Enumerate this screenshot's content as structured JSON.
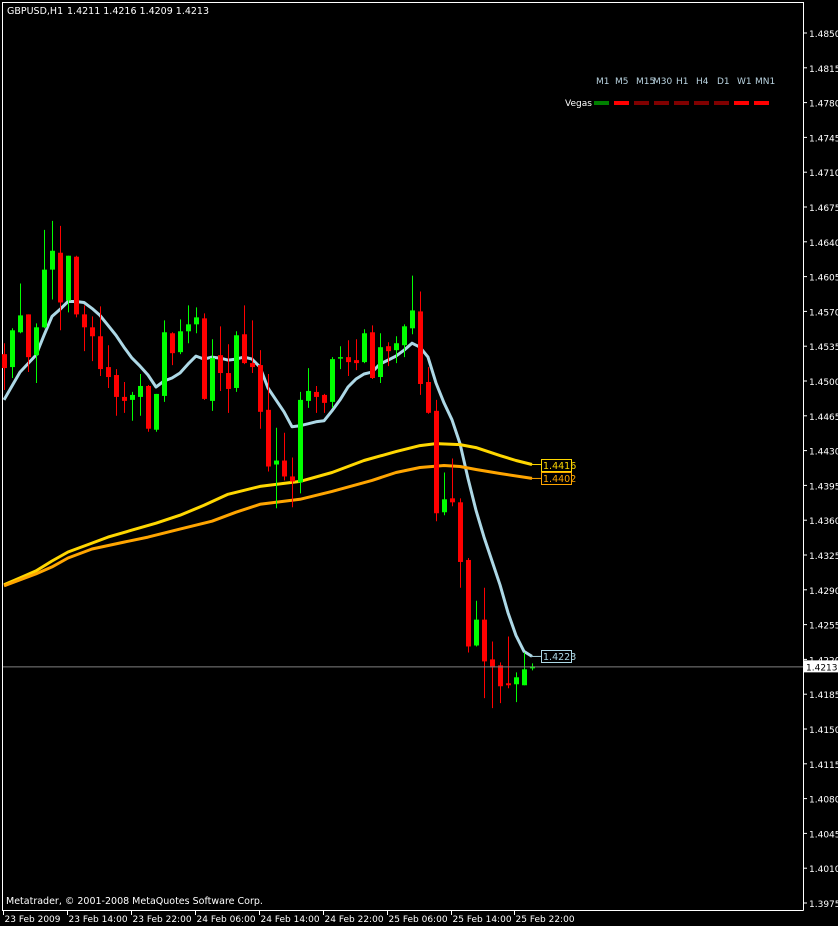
{
  "header": {
    "symbol": "GBPUSD,H1",
    "ohlc": "1.4211 1.4216 1.4209 1.4213"
  },
  "copyright": "Metatrader, © 2001-2008 MetaQuotes Software Corp.",
  "vegas": {
    "label": "Vegas",
    "timeframes": [
      {
        "name": "M1",
        "color": "#008000"
      },
      {
        "name": "M5",
        "color": "#ff0000"
      },
      {
        "name": "M15",
        "color": "#800000"
      },
      {
        "name": "M30",
        "color": "#800000"
      },
      {
        "name": "H1",
        "color": "#800000"
      },
      {
        "name": "H4",
        "color": "#800000"
      },
      {
        "name": "D1",
        "color": "#800000"
      },
      {
        "name": "W1",
        "color": "#ff0000"
      },
      {
        "name": "MN1",
        "color": "#ff0000"
      }
    ]
  },
  "chart_data": {
    "type": "candlestick",
    "symbol": "GBPUSD",
    "timeframe": "H1",
    "ylim": [
      1.3975,
      1.485
    ],
    "y_ticks": [
      "1.4850",
      "1.4815",
      "1.4780",
      "1.4745",
      "1.4710",
      "1.4675",
      "1.4640",
      "1.4605",
      "1.4570",
      "1.4535",
      "1.4500",
      "1.4465",
      "1.4430",
      "1.4395",
      "1.4360",
      "1.4325",
      "1.4290",
      "1.4255",
      "1.4220",
      "1.4185",
      "1.4150",
      "1.4115",
      "1.4080",
      "1.4045",
      "1.4010",
      "1.3975"
    ],
    "x_ticks": [
      "23 Feb 2009",
      "23 Feb 14:00",
      "23 Feb 22:00",
      "24 Feb 06:00",
      "24 Feb 14:00",
      "24 Feb 22:00",
      "25 Feb 06:00",
      "25 Feb 14:00",
      "25 Feb 22:00"
    ],
    "colors": {
      "bull": "#00ff00",
      "bear": "#ff0000",
      "background": "#000000",
      "grid": "off"
    },
    "current_price": "1.4213",
    "candles_fields": [
      "time",
      "open",
      "high",
      "low",
      "close"
    ],
    "candles": [
      [
        "23 Feb 06:00",
        1.4527,
        1.4538,
        1.4491,
        1.4513
      ],
      [
        "23 Feb 07:00",
        1.4514,
        1.4553,
        1.4503,
        1.4551
      ],
      [
        "23 Feb 08:00",
        1.4549,
        1.4598,
        1.4548,
        1.4566
      ],
      [
        "23 Feb 09:00",
        1.4567,
        1.4567,
        1.4509,
        1.4524
      ],
      [
        "23 Feb 10:00",
        1.4526,
        1.4558,
        1.4498,
        1.4554
      ],
      [
        "23 Feb 11:00",
        1.4554,
        1.4652,
        1.4553,
        1.4612
      ],
      [
        "23 Feb 12:00",
        1.4612,
        1.4661,
        1.4582,
        1.4631
      ],
      [
        "23 Feb 13:00",
        1.4629,
        1.4656,
        1.4551,
        1.4579
      ],
      [
        "23 Feb 14:00",
        1.4581,
        1.4626,
        1.4569,
        1.4626
      ],
      [
        "23 Feb 15:00",
        1.4625,
        1.4626,
        1.4564,
        1.4567
      ],
      [
        "23 Feb 16:00",
        1.4567,
        1.4576,
        1.453,
        1.4554
      ],
      [
        "23 Feb 17:00",
        1.4554,
        1.4565,
        1.452,
        1.4545
      ],
      [
        "23 Feb 18:00",
        1.4545,
        1.4575,
        1.4505,
        1.4512
      ],
      [
        "23 Feb 19:00",
        1.4514,
        1.4536,
        1.4493,
        1.4504
      ],
      [
        "23 Feb 20:00",
        1.4506,
        1.4512,
        1.4465,
        1.4484
      ],
      [
        "23 Feb 21:00",
        1.4484,
        1.4499,
        1.4468,
        1.448
      ],
      [
        "23 Feb 22:00",
        1.4481,
        1.4489,
        1.446,
        1.4486
      ],
      [
        "23 Feb 23:00",
        1.4484,
        1.4507,
        1.4465,
        1.4495
      ],
      [
        "24 Feb 00:00",
        1.4495,
        1.4496,
        1.4449,
        1.4452
      ],
      [
        "24 Feb 01:00",
        1.4451,
        1.4487,
        1.4449,
        1.4487
      ],
      [
        "24 Feb 02:00",
        1.4485,
        1.4561,
        1.4479,
        1.4549
      ],
      [
        "24 Feb 03:00",
        1.4548,
        1.4549,
        1.4516,
        1.4528
      ],
      [
        "24 Feb 04:00",
        1.4529,
        1.4562,
        1.4527,
        1.455
      ],
      [
        "24 Feb 05:00",
        1.455,
        1.4576,
        1.4538,
        1.4557
      ],
      [
        "24 Feb 06:00",
        1.4557,
        1.4574,
        1.4548,
        1.4564
      ],
      [
        "24 Feb 07:00",
        1.4563,
        1.4568,
        1.4481,
        1.4482
      ],
      [
        "24 Feb 08:00",
        1.448,
        1.4542,
        1.447,
        1.4523
      ],
      [
        "24 Feb 09:00",
        1.4526,
        1.4555,
        1.449,
        1.4508
      ],
      [
        "24 Feb 10:00",
        1.4508,
        1.4537,
        1.4468,
        1.4492
      ],
      [
        "24 Feb 11:00",
        1.4493,
        1.455,
        1.4489,
        1.4546
      ],
      [
        "24 Feb 12:00",
        1.4547,
        1.4576,
        1.4517,
        1.4518
      ],
      [
        "24 Feb 13:00",
        1.4518,
        1.4561,
        1.4508,
        1.4514
      ],
      [
        "24 Feb 14:00",
        1.4516,
        1.4531,
        1.4452,
        1.4469
      ],
      [
        "24 Feb 15:00",
        1.4471,
        1.4507,
        1.4409,
        1.4414
      ],
      [
        "24 Feb 16:00",
        1.4416,
        1.4453,
        1.4372,
        1.442
      ],
      [
        "24 Feb 17:00",
        1.442,
        1.4448,
        1.44,
        1.4404
      ],
      [
        "24 Feb 18:00",
        1.4404,
        1.4423,
        1.4373,
        1.4399
      ],
      [
        "24 Feb 19:00",
        1.4398,
        1.4489,
        1.4387,
        1.4481
      ],
      [
        "24 Feb 20:00",
        1.448,
        1.4513,
        1.4473,
        1.449
      ],
      [
        "24 Feb 21:00",
        1.4489,
        1.4495,
        1.4468,
        1.4484
      ],
      [
        "24 Feb 22:00",
        1.4486,
        1.4487,
        1.4468,
        1.4478
      ],
      [
        "24 Feb 23:00",
        1.4479,
        1.4524,
        1.4473,
        1.4522
      ],
      [
        "25 Feb 00:00",
        1.4523,
        1.4535,
        1.4512,
        1.4524
      ],
      [
        "25 Feb 01:00",
        1.4524,
        1.4541,
        1.4505,
        1.4519
      ],
      [
        "25 Feb 02:00",
        1.4521,
        1.4542,
        1.4511,
        1.4518
      ],
      [
        "25 Feb 03:00",
        1.4519,
        1.4552,
        1.4518,
        1.4548
      ],
      [
        "25 Feb 04:00",
        1.4549,
        1.4556,
        1.4502,
        1.4503
      ],
      [
        "25 Feb 05:00",
        1.4504,
        1.4548,
        1.4498,
        1.4534
      ],
      [
        "25 Feb 06:00",
        1.4535,
        1.4539,
        1.4515,
        1.453
      ],
      [
        "25 Feb 07:00",
        1.4531,
        1.4545,
        1.4518,
        1.4538
      ],
      [
        "25 Feb 08:00",
        1.4536,
        1.4557,
        1.4524,
        1.4555
      ],
      [
        "25 Feb 09:00",
        1.4553,
        1.4606,
        1.4547,
        1.4571
      ],
      [
        "25 Feb 10:00",
        1.457,
        1.459,
        1.4486,
        1.4497
      ],
      [
        "25 Feb 11:00",
        1.4499,
        1.4514,
        1.4467,
        1.4468
      ],
      [
        "25 Feb 12:00",
        1.447,
        1.4481,
        1.4359,
        1.4367
      ],
      [
        "25 Feb 13:00",
        1.4368,
        1.4408,
        1.4365,
        1.4381
      ],
      [
        "25 Feb 14:00",
        1.4382,
        1.4422,
        1.4374,
        1.4378
      ],
      [
        "25 Feb 15:00",
        1.4378,
        1.4382,
        1.4292,
        1.4318
      ],
      [
        "25 Feb 16:00",
        1.432,
        1.4322,
        1.4227,
        1.4233
      ],
      [
        "25 Feb 17:00",
        1.4234,
        1.4279,
        1.4233,
        1.426
      ],
      [
        "25 Feb 18:00",
        1.426,
        1.4292,
        1.4181,
        1.4218
      ],
      [
        "25 Feb 19:00",
        1.422,
        1.4238,
        1.4171,
        1.4212
      ],
      [
        "25 Feb 20:00",
        1.4214,
        1.4217,
        1.4176,
        1.4193
      ],
      [
        "25 Feb 21:00",
        1.4196,
        1.4243,
        1.4191,
        1.4194
      ],
      [
        "25 Feb 22:00",
        1.4195,
        1.4207,
        1.4177,
        1.4202
      ],
      [
        "25 Feb 23:00",
        1.4194,
        1.4227,
        1.4194,
        1.421
      ],
      [
        "26 Feb 00:00",
        1.4211,
        1.4216,
        1.4209,
        1.4213
      ]
    ],
    "lines": [
      {
        "color": "#add8e6",
        "last_label": "1.4223",
        "points": [
          [
            "23 Feb 06:00",
            1.4481
          ],
          [
            "23 Feb 08:00",
            1.4509
          ],
          [
            "23 Feb 10:00",
            1.4526
          ],
          [
            "23 Feb 11:00",
            1.4546
          ],
          [
            "23 Feb 12:00",
            1.4565
          ],
          [
            "23 Feb 13:00",
            1.4572
          ],
          [
            "23 Feb 14:00",
            1.458
          ],
          [
            "23 Feb 15:00",
            1.458
          ],
          [
            "23 Feb 16:00",
            1.4579
          ],
          [
            "23 Feb 17:00",
            1.4573
          ],
          [
            "23 Feb 18:00",
            1.4566
          ],
          [
            "23 Feb 19:00",
            1.4556
          ],
          [
            "23 Feb 20:00",
            1.4546
          ],
          [
            "23 Feb 21:00",
            1.4534
          ],
          [
            "23 Feb 22:00",
            1.4523
          ],
          [
            "23 Feb 23:00",
            1.4515
          ],
          [
            "24 Feb 00:00",
            1.4506
          ],
          [
            "24 Feb 01:00",
            1.4494
          ],
          [
            "24 Feb 02:00",
            1.45
          ],
          [
            "24 Feb 03:00",
            1.4503
          ],
          [
            "24 Feb 04:00",
            1.4508
          ],
          [
            "24 Feb 05:00",
            1.4517
          ],
          [
            "24 Feb 06:00",
            1.4525
          ],
          [
            "24 Feb 07:00",
            1.4522
          ],
          [
            "24 Feb 08:00",
            1.4524
          ],
          [
            "24 Feb 09:00",
            1.4523
          ],
          [
            "24 Feb 10:00",
            1.4521
          ],
          [
            "24 Feb 11:00",
            1.4522
          ],
          [
            "24 Feb 12:00",
            1.4524
          ],
          [
            "24 Feb 13:00",
            1.4522
          ],
          [
            "24 Feb 14:00",
            1.4514
          ],
          [
            "24 Feb 15:00",
            1.4493
          ],
          [
            "24 Feb 16:00",
            1.4481
          ],
          [
            "24 Feb 17:00",
            1.4469
          ],
          [
            "24 Feb 18:00",
            1.4454
          ],
          [
            "24 Feb 19:00",
            1.4455
          ],
          [
            "24 Feb 20:00",
            1.4457
          ],
          [
            "24 Feb 21:00",
            1.4459
          ],
          [
            "24 Feb 22:00",
            1.446
          ],
          [
            "24 Feb 23:00",
            1.447
          ],
          [
            "25 Feb 00:00",
            1.4481
          ],
          [
            "25 Feb 01:00",
            1.4494
          ],
          [
            "25 Feb 02:00",
            1.4502
          ],
          [
            "25 Feb 03:00",
            1.4507
          ],
          [
            "25 Feb 04:00",
            1.4509
          ],
          [
            "25 Feb 05:00",
            1.4517
          ],
          [
            "25 Feb 06:00",
            1.4521
          ],
          [
            "25 Feb 07:00",
            1.4525
          ],
          [
            "25 Feb 08:00",
            1.4531
          ],
          [
            "25 Feb 09:00",
            1.4538
          ],
          [
            "25 Feb 10:00",
            1.4534
          ],
          [
            "25 Feb 11:00",
            1.4524
          ],
          [
            "25 Feb 12:00",
            1.4498
          ],
          [
            "25 Feb 13:00",
            1.4478
          ],
          [
            "25 Feb 14:00",
            1.4461
          ],
          [
            "25 Feb 15:00",
            1.4437
          ],
          [
            "25 Feb 16:00",
            1.4402
          ],
          [
            "25 Feb 17:00",
            1.437
          ],
          [
            "25 Feb 18:00",
            1.4343
          ],
          [
            "25 Feb 19:00",
            1.4319
          ],
          [
            "25 Feb 20:00",
            1.4295
          ],
          [
            "25 Feb 21:00",
            1.4267
          ],
          [
            "25 Feb 22:00",
            1.4244
          ],
          [
            "25 Feb 23:00",
            1.4228
          ],
          [
            "26 Feb 00:00",
            1.4223
          ]
        ]
      },
      {
        "color": "#ffd700",
        "last_label": "1.4416",
        "points": [
          [
            "23 Feb 06:00",
            1.4295
          ],
          [
            "23 Feb 08:00",
            1.4302
          ],
          [
            "23 Feb 10:00",
            1.4309
          ],
          [
            "23 Feb 12:00",
            1.4319
          ],
          [
            "23 Feb 14:00",
            1.4328
          ],
          [
            "23 Feb 17:00",
            1.4337
          ],
          [
            "23 Feb 19:00",
            1.4343
          ],
          [
            "23 Feb 22:00",
            1.435
          ],
          [
            "24 Feb 01:00",
            1.4357
          ],
          [
            "24 Feb 04:00",
            1.4365
          ],
          [
            "24 Feb 07:00",
            1.4375
          ],
          [
            "24 Feb 10:00",
            1.4386
          ],
          [
            "24 Feb 14:00",
            1.4394
          ],
          [
            "24 Feb 16:00",
            1.4396
          ],
          [
            "24 Feb 19:00",
            1.4399
          ],
          [
            "24 Feb 23:00",
            1.4408
          ],
          [
            "25 Feb 03:00",
            1.442
          ],
          [
            "25 Feb 07:00",
            1.4429
          ],
          [
            "25 Feb 10:00",
            1.4435
          ],
          [
            "25 Feb 12:00",
            1.4437
          ],
          [
            "25 Feb 15:00",
            1.4436
          ],
          [
            "25 Feb 17:00",
            1.4433
          ],
          [
            "25 Feb 20:00",
            1.4425
          ],
          [
            "25 Feb 22:00",
            1.442
          ],
          [
            "26 Feb 00:00",
            1.4416
          ]
        ]
      },
      {
        "color": "#ffa500",
        "last_label": "1.4402",
        "points": [
          [
            "23 Feb 06:00",
            1.4294
          ],
          [
            "23 Feb 10:00",
            1.4306
          ],
          [
            "23 Feb 12:00",
            1.4313
          ],
          [
            "23 Feb 14:00",
            1.4322
          ],
          [
            "23 Feb 17:00",
            1.4331
          ],
          [
            "23 Feb 21:00",
            1.4338
          ],
          [
            "24 Feb 00:00",
            1.4343
          ],
          [
            "24 Feb 04:00",
            1.4351
          ],
          [
            "24 Feb 08:00",
            1.4359
          ],
          [
            "24 Feb 11:00",
            1.4368
          ],
          [
            "24 Feb 14:00",
            1.4376
          ],
          [
            "24 Feb 16:00",
            1.4378
          ],
          [
            "24 Feb 19:00",
            1.4381
          ],
          [
            "24 Feb 23:00",
            1.4389
          ],
          [
            "25 Feb 04:00",
            1.44
          ],
          [
            "25 Feb 07:00",
            1.4408
          ],
          [
            "25 Feb 10:00",
            1.4413
          ],
          [
            "25 Feb 13:00",
            1.4415
          ],
          [
            "25 Feb 15:00",
            1.4414
          ],
          [
            "25 Feb 17:00",
            1.4411
          ],
          [
            "25 Feb 20:00",
            1.4407
          ],
          [
            "26 Feb 00:00",
            1.4402
          ]
        ]
      }
    ]
  }
}
